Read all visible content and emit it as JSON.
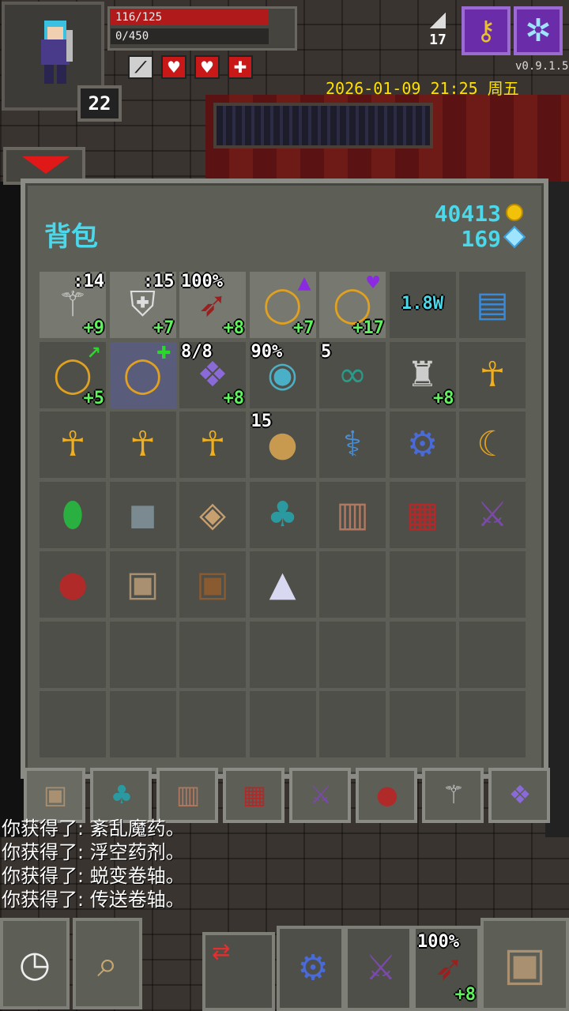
{
  "hud": {
    "hp_text": "116/125",
    "hp_fraction": 0.928,
    "xp_text": "0/450",
    "xp_fraction": 0.0,
    "level": "22",
    "depth": "17",
    "version": "v0.9.1.5",
    "datetime": "2026-01-09 21:25 周五",
    "buffs": [
      "sword-icon",
      "heart-icon",
      "heart-icon",
      "shield-icon"
    ],
    "buff_colors": [
      "#cfcfcf",
      "#c81818",
      "#c81818",
      "#c81818"
    ]
  },
  "bag": {
    "title": "背包",
    "gold": "40413",
    "gems": "169",
    "rows": [
      [
        {
          "icon": "wand-icon",
          "glyph": "⚚",
          "color": "#ccc",
          "tl": "",
          "tr": ":14",
          "br": "+9",
          "light": true
        },
        {
          "icon": "armor-icon",
          "glyph": "⛨",
          "color": "#ddd",
          "tl": "",
          "tr": ":15",
          "br": "+7",
          "light": true
        },
        {
          "icon": "weapon-icon",
          "glyph": "➶",
          "color": "#9a2020",
          "tl": "100%",
          "tr": "",
          "br": "+8",
          "light": true
        },
        {
          "icon": "ring-icon",
          "glyph": "◯",
          "color": "#e0a020",
          "tl": "",
          "tr": "",
          "br": "+7",
          "light": true,
          "up": "▲"
        },
        {
          "icon": "ring-icon",
          "glyph": "◯",
          "color": "#e0a020",
          "tl": "",
          "tr": "",
          "br": "+17",
          "light": true,
          "up": "♥"
        },
        {
          "icon": "energy-label",
          "glyph": "",
          "color": "#4ad8ea",
          "tl": "",
          "tr": "",
          "br": "",
          "mid": "1.8W",
          "light": false
        },
        {
          "icon": "stone-stack-icon",
          "glyph": "▤",
          "color": "#3a8ad8",
          "tl": "",
          "tr": "",
          "br": "",
          "light": false
        }
      ],
      [
        {
          "icon": "ring-icon",
          "glyph": "◯",
          "color": "#e0a020",
          "tl": "",
          "tr": "",
          "br": "+5",
          "light": false,
          "up": "↗"
        },
        {
          "icon": "ring-icon",
          "glyph": "◯",
          "color": "#e0a020",
          "tl": "",
          "tr": "",
          "br": "",
          "light": false,
          "sel": true,
          "up": "✚"
        },
        {
          "icon": "artifact-icon",
          "glyph": "❖",
          "color": "#8a6ad8",
          "tl": "8/8",
          "tr": "",
          "br": "+8",
          "light": false
        },
        {
          "icon": "drum-icon",
          "glyph": "◉",
          "color": "#4ab0c8",
          "tl": "90%",
          "tr": "",
          "br": "",
          "light": false
        },
        {
          "icon": "chain-icon",
          "glyph": "∞",
          "color": "#2a9a8a",
          "tl": "5",
          "tr": "",
          "br": "",
          "light": false
        },
        {
          "icon": "chalice-icon",
          "glyph": "♜",
          "color": "#ccc",
          "tl": "",
          "tr": "",
          "br": "+8",
          "light": false
        },
        {
          "icon": "ankh-icon",
          "glyph": "☥",
          "color": "#f0b020",
          "tl": "",
          "tr": "",
          "br": "",
          "light": false
        }
      ],
      [
        {
          "icon": "ankh-icon",
          "glyph": "☥",
          "color": "#f0b020",
          "tl": "",
          "tr": "",
          "br": "",
          "light": false
        },
        {
          "icon": "ankh-icon",
          "glyph": "☥",
          "color": "#f0b020",
          "tl": "",
          "tr": "",
          "br": "",
          "light": false
        },
        {
          "icon": "ankh-icon",
          "glyph": "☥",
          "color": "#f0b020",
          "tl": "",
          "tr": "",
          "br": "",
          "light": false
        },
        {
          "icon": "honey-pot-icon",
          "glyph": "●",
          "color": "#c89a50",
          "tl": "15",
          "tr": "",
          "br": "",
          "light": false
        },
        {
          "icon": "horn-icon",
          "glyph": "⚕",
          "color": "#4a90d8",
          "tl": "",
          "tr": "",
          "br": "",
          "light": false
        },
        {
          "icon": "gear-icon",
          "glyph": "⚙",
          "color": "#4a6ad8",
          "tl": "",
          "tr": "",
          "br": "",
          "light": false
        },
        {
          "icon": "crescent-icon",
          "glyph": "☾",
          "color": "#e0a020",
          "tl": "",
          "tr": "",
          "br": "",
          "light": false
        }
      ],
      [
        {
          "icon": "emerald-icon",
          "glyph": "⬮",
          "color": "#2ab040",
          "tl": "",
          "tr": "",
          "br": "",
          "light": false
        },
        {
          "icon": "rune-stone-icon",
          "glyph": "◼",
          "color": "#7a8a90",
          "tl": "",
          "tr": "",
          "br": "",
          "light": false
        },
        {
          "icon": "compass-icon",
          "glyph": "◈",
          "color": "#c8a070",
          "tl": "",
          "tr": "",
          "br": "",
          "light": false
        },
        {
          "icon": "seed-bag-icon",
          "glyph": "♣",
          "color": "#2a9aa0",
          "tl": "",
          "tr": "",
          "br": "",
          "light": false
        },
        {
          "icon": "scroll-holder-icon",
          "glyph": "▥",
          "color": "#b07860",
          "tl": "",
          "tr": "",
          "br": "",
          "light": false
        },
        {
          "icon": "potion-belt-icon",
          "glyph": "▦",
          "color": "#b02a2a",
          "tl": "",
          "tr": "",
          "br": "",
          "light": false
        },
        {
          "icon": "wand-holster-icon",
          "glyph": "⚔",
          "color": "#7a4aa8",
          "tl": "",
          "tr": "",
          "br": "",
          "light": false
        }
      ],
      [
        {
          "icon": "pouch-icon",
          "glyph": "●",
          "color": "#b02a2a",
          "tl": "",
          "tr": "",
          "br": "",
          "light": false
        },
        {
          "icon": "backpack-icon",
          "glyph": "▣",
          "color": "#a89070",
          "tl": "",
          "tr": "",
          "br": "",
          "light": false
        },
        {
          "icon": "satchel-icon",
          "glyph": "▣",
          "color": "#8a5a30",
          "tl": "",
          "tr": "",
          "br": "",
          "light": false
        },
        {
          "icon": "crystal-icon",
          "glyph": "▲",
          "color": "#d8d8f0",
          "tl": "",
          "tr": "",
          "br": "",
          "light": false
        },
        {
          "icon": "empty",
          "glyph": "",
          "color": "#fff",
          "tl": "",
          "tr": "",
          "br": "",
          "light": false
        },
        {
          "icon": "empty",
          "glyph": "",
          "color": "#fff",
          "tl": "",
          "tr": "",
          "br": "",
          "light": false
        },
        {
          "icon": "empty",
          "glyph": "",
          "color": "#fff",
          "tl": "",
          "tr": "",
          "br": "",
          "light": false
        }
      ],
      [
        {
          "icon": "empty",
          "glyph": "",
          "color": "#fff",
          "tl": "",
          "tr": "",
          "br": "",
          "light": false
        },
        {
          "icon": "empty",
          "glyph": "",
          "color": "#fff",
          "tl": "",
          "tr": "",
          "br": "",
          "light": false
        },
        {
          "icon": "empty",
          "glyph": "",
          "color": "#fff",
          "tl": "",
          "tr": "",
          "br": "",
          "light": false
        },
        {
          "icon": "empty",
          "glyph": "",
          "color": "#fff",
          "tl": "",
          "tr": "",
          "br": "",
          "light": false
        },
        {
          "icon": "empty",
          "glyph": "",
          "color": "#fff",
          "tl": "",
          "tr": "",
          "br": "",
          "light": false
        },
        {
          "icon": "empty",
          "glyph": "",
          "color": "#fff",
          "tl": "",
          "tr": "",
          "br": "",
          "light": false
        },
        {
          "icon": "empty",
          "glyph": "",
          "color": "#fff",
          "tl": "",
          "tr": "",
          "br": "",
          "light": false
        }
      ],
      [
        {
          "icon": "empty",
          "glyph": "",
          "color": "#fff",
          "tl": "",
          "tr": "",
          "br": "",
          "light": false
        },
        {
          "icon": "empty",
          "glyph": "",
          "color": "#fff",
          "tl": "",
          "tr": "",
          "br": "",
          "light": false
        },
        {
          "icon": "empty",
          "glyph": "",
          "color": "#fff",
          "tl": "",
          "tr": "",
          "br": "",
          "light": false
        },
        {
          "icon": "empty",
          "glyph": "",
          "color": "#fff",
          "tl": "",
          "tr": "",
          "br": "",
          "light": false
        },
        {
          "icon": "empty",
          "glyph": "",
          "color": "#fff",
          "tl": "",
          "tr": "",
          "br": "",
          "light": false
        },
        {
          "icon": "empty",
          "glyph": "",
          "color": "#fff",
          "tl": "",
          "tr": "",
          "br": "",
          "light": false
        },
        {
          "icon": "empty",
          "glyph": "",
          "color": "#fff",
          "tl": "",
          "tr": "",
          "br": "",
          "light": false
        }
      ]
    ],
    "tabs": [
      {
        "icon": "backpack-tab-icon",
        "glyph": "▣",
        "color": "#a89070"
      },
      {
        "icon": "seed-bag-tab-icon",
        "glyph": "♣",
        "color": "#2a9aa0"
      },
      {
        "icon": "scroll-holder-tab-icon",
        "glyph": "▥",
        "color": "#b07860"
      },
      {
        "icon": "potion-belt-tab-icon",
        "glyph": "▦",
        "color": "#b02a2a"
      },
      {
        "icon": "wand-holster-tab-icon",
        "glyph": "⚔",
        "color": "#7a4aa8"
      },
      {
        "icon": "pouch-tab-icon",
        "glyph": "●",
        "color": "#b02a2a"
      },
      {
        "icon": "wand-tab-icon",
        "glyph": "⚚",
        "color": "#ccc"
      },
      {
        "icon": "artifact-tab-icon",
        "glyph": "❖",
        "color": "#8a6ad8"
      }
    ]
  },
  "log": [
    "你获得了: 紊乱魔药。",
    "你获得了: 浮空药剂。",
    "你获得了: 蜕变卷轴。",
    "你获得了: 传送卷轴。"
  ],
  "toolbar": {
    "wait_icon": "clock-icon",
    "search_icon": "magnifier-icon",
    "swap_icon": "swap-icon",
    "quickslots": [
      {
        "icon": "gear-icon",
        "glyph": "⚙",
        "color": "#4a6ad8",
        "tl": "",
        "br": ""
      },
      {
        "icon": "wand-holster-icon",
        "glyph": "⚔",
        "color": "#7a4aa8",
        "tl": "",
        "br": ""
      },
      {
        "icon": "weapon-icon",
        "glyph": "➶",
        "color": "#9a2020",
        "tl": "100%",
        "br": "+8"
      }
    ],
    "inventory_icon": "backpack-icon"
  }
}
